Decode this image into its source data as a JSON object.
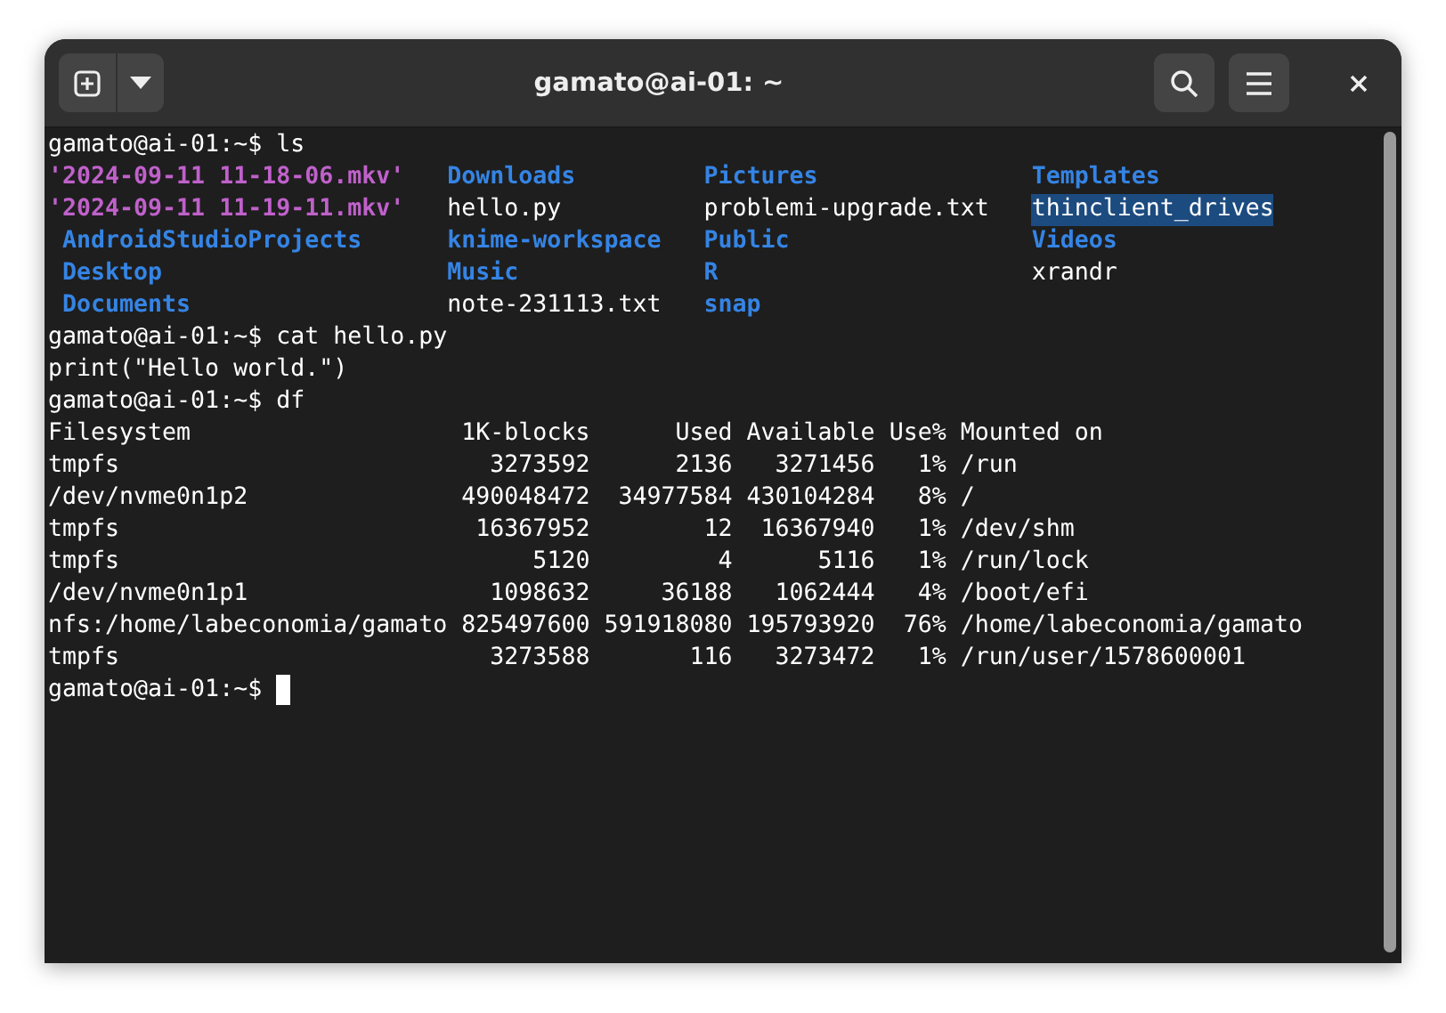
{
  "window": {
    "title": "gamato@ai-01: ~"
  },
  "terminal": {
    "lines": [
      {
        "kind": "prompt",
        "text": "gamato@ai-01:~$ ls"
      },
      {
        "kind": "ls",
        "entries": [
          {
            "text": "'2024-09-11 11-18-06.mkv'",
            "kind": "video",
            "selected": false
          },
          {
            "text": "Downloads",
            "kind": "dir",
            "selected": false
          },
          {
            "text": "Pictures",
            "kind": "dir",
            "selected": false
          },
          {
            "text": "Templates",
            "kind": "dir",
            "selected": false
          }
        ]
      },
      {
        "kind": "ls",
        "entries": [
          {
            "text": "'2024-09-11 11-19-11.mkv'",
            "kind": "video",
            "selected": false
          },
          {
            "text": "hello.py",
            "kind": "file",
            "selected": false
          },
          {
            "text": "problemi-upgrade.txt",
            "kind": "file",
            "selected": false
          },
          {
            "text": "thinclient_drives",
            "kind": "file",
            "selected": true
          }
        ]
      },
      {
        "kind": "ls",
        "entries": [
          {
            "text": " AndroidStudioProjects",
            "kind": "dir",
            "selected": false
          },
          {
            "text": "knime-workspace",
            "kind": "dir",
            "selected": false
          },
          {
            "text": "Public",
            "kind": "dir",
            "selected": false
          },
          {
            "text": "Videos",
            "kind": "dir",
            "selected": false
          }
        ]
      },
      {
        "kind": "ls",
        "entries": [
          {
            "text": " Desktop",
            "kind": "dir",
            "selected": false
          },
          {
            "text": "Music",
            "kind": "dir",
            "selected": false
          },
          {
            "text": "R",
            "kind": "dir",
            "selected": false
          },
          {
            "text": "xrandr",
            "kind": "file",
            "selected": false
          }
        ]
      },
      {
        "kind": "ls",
        "entries": [
          {
            "text": " Documents",
            "kind": "dir",
            "selected": false
          },
          {
            "text": "note-231113.txt",
            "kind": "file",
            "selected": false
          },
          {
            "text": "snap",
            "kind": "dir",
            "selected": false
          }
        ]
      },
      {
        "kind": "prompt",
        "text": "gamato@ai-01:~$ cat hello.py"
      },
      {
        "kind": "output",
        "text": "print(\"Hello world.\")"
      },
      {
        "kind": "prompt",
        "text": "gamato@ai-01:~$ df"
      },
      {
        "kind": "output",
        "text": "Filesystem                   1K-blocks      Used Available Use% Mounted on"
      },
      {
        "kind": "output",
        "text": "tmpfs                          3273592      2136   3271456   1% /run"
      },
      {
        "kind": "output",
        "text": "/dev/nvme0n1p2               490048472  34977584 430104284   8% /"
      },
      {
        "kind": "output",
        "text": "tmpfs                         16367952        12  16367940   1% /dev/shm"
      },
      {
        "kind": "output",
        "text": "tmpfs                             5120         4      5116   1% /run/lock"
      },
      {
        "kind": "output",
        "text": "/dev/nvme0n1p1                 1098632     36188   1062444   4% /boot/efi"
      },
      {
        "kind": "output",
        "text": "nfs:/home/labeconomia/gamato 825497600 591918080 195793920  76% /home/labeconomia/gamato"
      },
      {
        "kind": "output",
        "text": "tmpfs                          3273588       116   3273472   1% /run/user/1578600001"
      },
      {
        "kind": "prompt",
        "text": "gamato@ai-01:~$",
        "cursor": true
      }
    ]
  }
}
